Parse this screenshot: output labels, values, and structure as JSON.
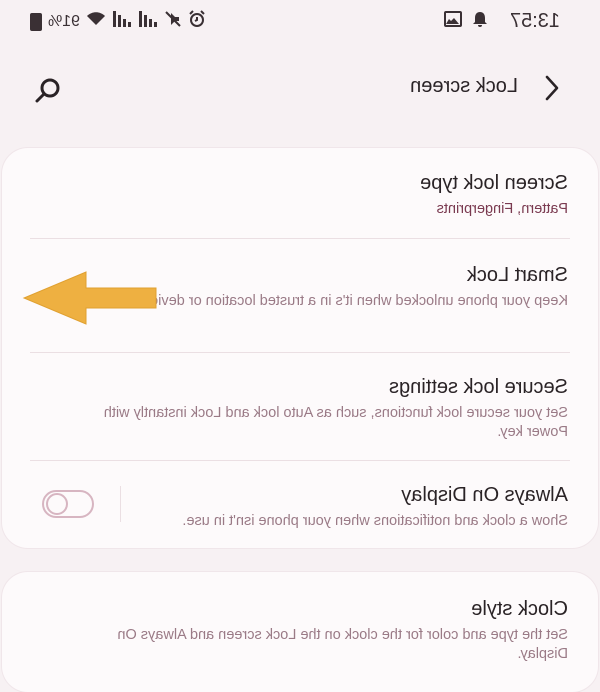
{
  "status_bar": {
    "time": "13:57",
    "battery_percent": "91%",
    "left_icons": [
      "notification-icon",
      "gallery-icon"
    ],
    "right_icons": [
      "alarm-icon",
      "mute-icon",
      "signal-icon",
      "signal-icon",
      "wifi-icon",
      "battery-icon"
    ]
  },
  "header": {
    "title": "Lock screen",
    "back_icon": "chevron-left-icon",
    "search_icon": "search-icon"
  },
  "settings": {
    "screen_lock_type": {
      "title": "Screen lock type",
      "subtitle": "Pattern, Fingerprints"
    },
    "smart_lock": {
      "title": "Smart Lock",
      "subtitle": "Keep your phone unlocked when it's in a trusted location or device nearby."
    },
    "secure_lock_settings": {
      "title": "Secure lock settings",
      "subtitle": "Set your secure lock functions, such as Auto lock and Lock instantly with Power key."
    },
    "always_on_display": {
      "title": "Always On Display",
      "subtitle": "Show a clock and notifications when your phone isn't in use.",
      "enabled": false
    },
    "clock_style": {
      "title": "Clock style",
      "subtitle": "Set the type and color for the clock on the Lock screen and Always On Display."
    }
  },
  "colors": {
    "background": "#f7f1f3",
    "card": "#fdfafb",
    "accent": "#7a3a50",
    "arrow": "#eeb041"
  }
}
